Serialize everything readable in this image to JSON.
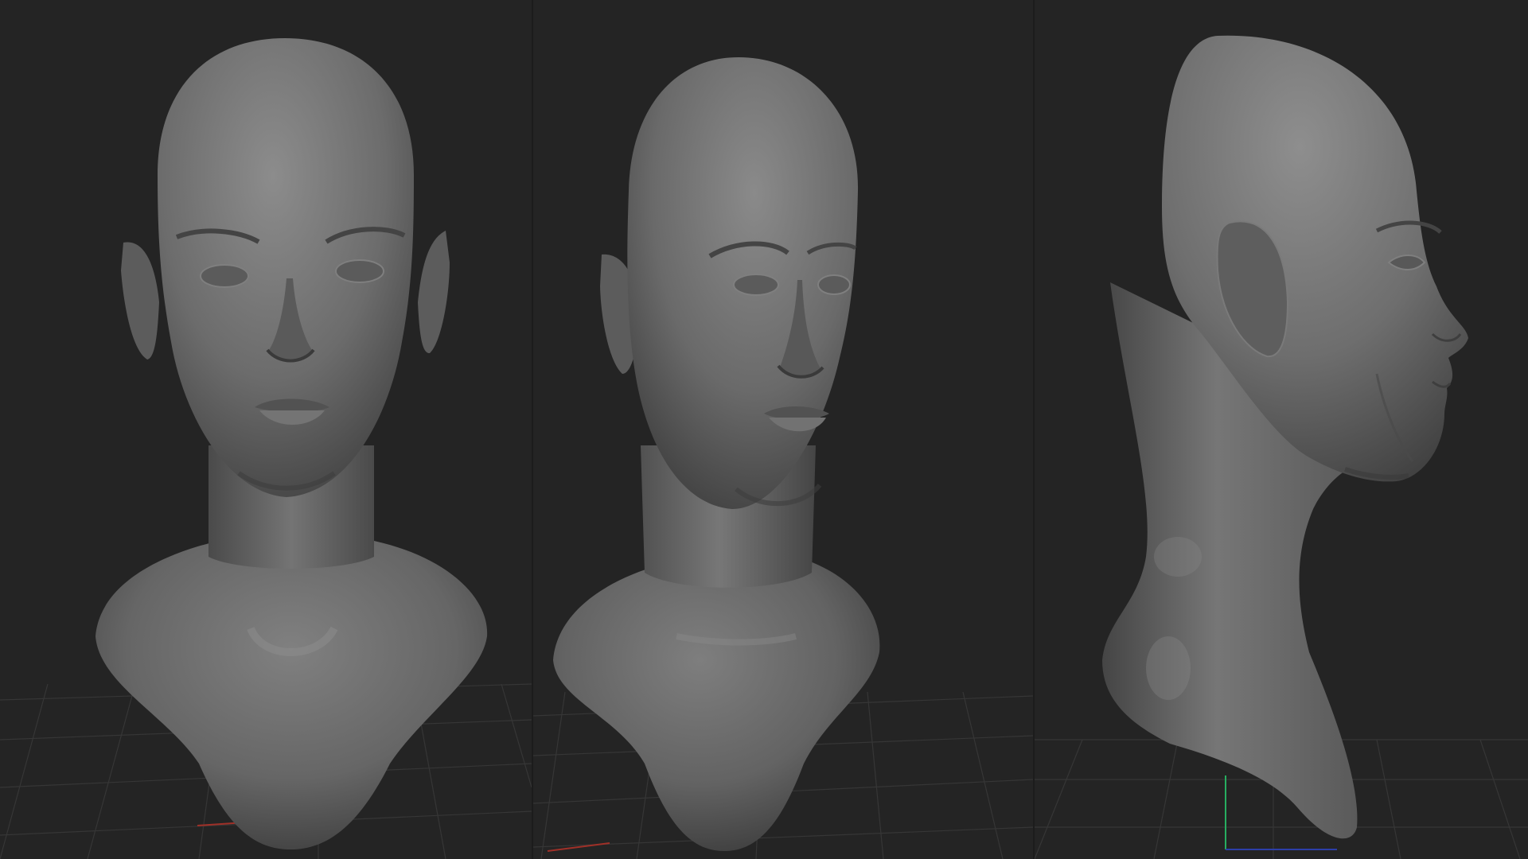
{
  "app": {
    "title": ""
  },
  "colors": {
    "background": "#232323",
    "grid_line": "#3a3a3a",
    "mesh_base": "#6e6e6e",
    "mesh_highlight": "#8a8a8a",
    "mesh_shadow": "#3a3a3a",
    "axis_x": "#c0392b",
    "axis_y": "#27ae60",
    "axis_z": "#2c3ea8"
  },
  "views": [
    {
      "id": "front",
      "icon": "head-front-icon"
    },
    {
      "id": "three-quarter",
      "icon": "head-three-quarter-icon"
    },
    {
      "id": "side",
      "icon": "head-profile-icon"
    }
  ]
}
